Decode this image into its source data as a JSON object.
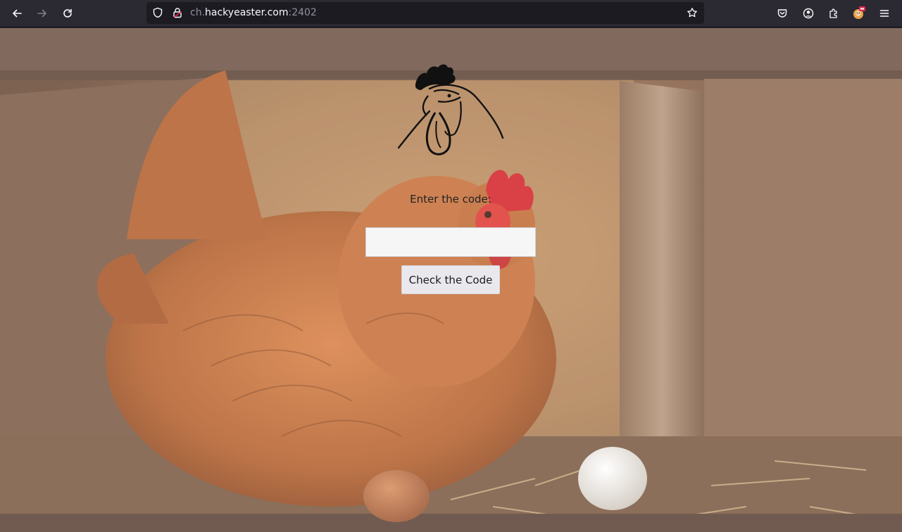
{
  "browser": {
    "url_prefix": "ch.",
    "url_domain": "hackyeaster.com",
    "url_port": ":2402",
    "icons": {
      "back": "back-arrow-icon",
      "forward": "forward-arrow-icon",
      "reload": "reload-icon",
      "tracking": "shield-icon",
      "site_info": "lock-icon",
      "bookmark": "star-icon",
      "pocket": "pocket-icon",
      "account": "account-icon",
      "extensions": "puzzle-icon",
      "profile": "profile-icon",
      "menu": "hamburger-menu-icon"
    }
  },
  "page": {
    "prompt_label": "Enter the code:",
    "code_input_value": "",
    "check_button_label": "Check the Code"
  },
  "colors": {
    "toolbar_bg": "#2b2a33",
    "urlbar_bg": "#1c1b22",
    "hen_body": "#b8622d",
    "comb_red": "#d4252c",
    "button_bg": "#e9e9ed"
  }
}
